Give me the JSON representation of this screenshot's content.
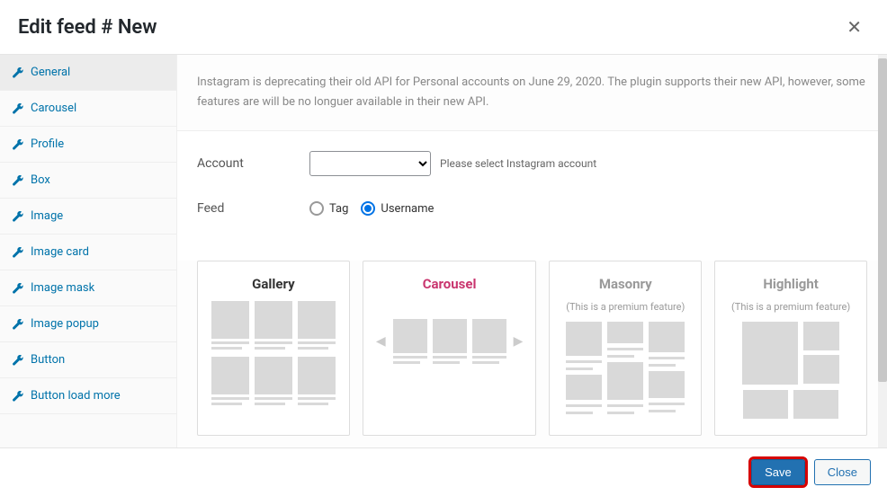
{
  "header": {
    "title": "Edit feed # New"
  },
  "sidebar": {
    "items": [
      {
        "label": "General"
      },
      {
        "label": "Carousel"
      },
      {
        "label": "Profile"
      },
      {
        "label": "Box"
      },
      {
        "label": "Image"
      },
      {
        "label": "Image card"
      },
      {
        "label": "Image mask"
      },
      {
        "label": "Image popup"
      },
      {
        "label": "Button"
      },
      {
        "label": "Button load more"
      }
    ]
  },
  "notice": "Instagram is deprecating their old API for Personal accounts on June 29, 2020. The plugin supports their new API, however, some features are will be no longuer available in their new API.",
  "form": {
    "accountLabel": "Account",
    "accountHint": "Please select Instagram account",
    "feedLabel": "Feed",
    "feedOptions": {
      "tag": "Tag",
      "username": "Username"
    }
  },
  "layouts": {
    "gallery": {
      "title": "Gallery"
    },
    "carousel": {
      "title": "Carousel"
    },
    "masonry": {
      "title": "Masonry",
      "sub": "(This is a premium feature)"
    },
    "highlight": {
      "title": "Highlight",
      "sub": "(This is a premium feature)"
    }
  },
  "footer": {
    "save": "Save",
    "close": "Close"
  }
}
